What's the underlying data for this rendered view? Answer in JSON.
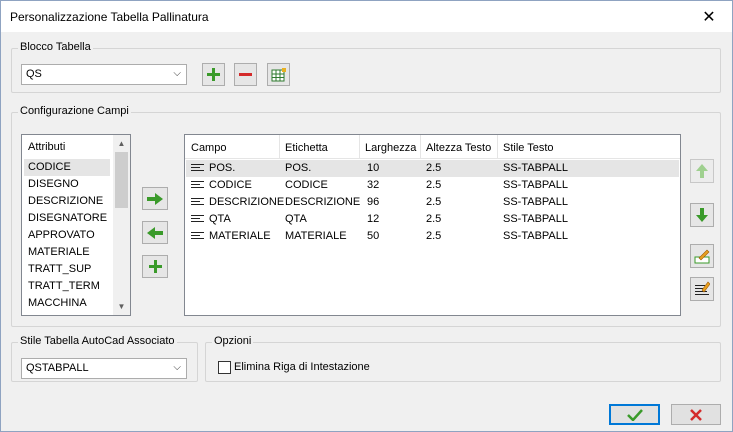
{
  "window": {
    "title": "Personalizzazione Tabella Pallinatura",
    "close_glyph": "✕"
  },
  "blocco": {
    "label": "Blocco Tabella",
    "selected": "QS",
    "buttons": [
      {
        "name": "add-block-button",
        "icon": "plus-icon"
      },
      {
        "name": "remove-block-button",
        "icon": "minus-icon"
      },
      {
        "name": "table-settings-button",
        "icon": "table-icon"
      }
    ]
  },
  "config": {
    "label": "Configurazione Campi",
    "attributi_header": "Attributi",
    "attributi": [
      "CODICE",
      "DISEGNO",
      "DESCRIZIONE",
      "DISEGNATORE",
      "APPROVATO",
      "MATERIALE",
      "TRATT_SUP",
      "TRATT_TERM",
      "MACCHINA"
    ],
    "columns": [
      "Campo",
      "Etichetta",
      "Larghezza",
      "Altezza Testo",
      "Stile Testo"
    ],
    "rows": [
      {
        "campo": "POS.",
        "etichetta": "POS.",
        "larghezza": "10",
        "altezza": "2.5",
        "stile": "SS-TABPALL"
      },
      {
        "campo": "CODICE",
        "etichetta": "CODICE",
        "larghezza": "32",
        "altezza": "2.5",
        "stile": "SS-TABPALL"
      },
      {
        "campo": "DESCRIZIONE",
        "etichetta": "DESCRIZIONE",
        "larghezza": "96",
        "altezza": "2.5",
        "stile": "SS-TABPALL"
      },
      {
        "campo": "QTA",
        "etichetta": "QTA",
        "larghezza": "12",
        "altezza": "2.5",
        "stile": "SS-TABPALL"
      },
      {
        "campo": "MATERIALE",
        "etichetta": "MATERIALE",
        "larghezza": "50",
        "altezza": "2.5",
        "stile": "SS-TABPALL"
      }
    ]
  },
  "stile": {
    "label": "Stile Tabella AutoCad Associato",
    "selected": "QSTABPALL"
  },
  "opzioni": {
    "label": "Opzioni",
    "checkbox_label": "Elimina Riga di Intestazione",
    "checked": false
  },
  "colors": {
    "green": "#3a9a2a",
    "red": "#d42a2a",
    "accent": "#0078d7"
  }
}
